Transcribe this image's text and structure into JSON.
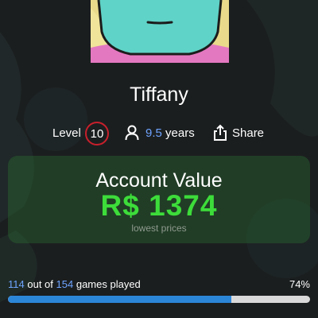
{
  "profile": {
    "username": "Tiffany",
    "level_label": "Level",
    "level": "10",
    "years_value": "9.5",
    "years_unit": "years",
    "share_label": "Share",
    "icons": {
      "account_age": "person-icon",
      "share": "share-icon"
    }
  },
  "account_value": {
    "title": "Account Value",
    "amount": "R$ 1374",
    "subtitle": "lowest prices"
  },
  "progress": {
    "played": "114",
    "out_of": "out of",
    "total": "154",
    "suffix": "games played",
    "percent_label": "74%",
    "fraction": 0.74
  },
  "colors": {
    "level_ring": "#c8202c",
    "accent_blue": "#6ea4ff",
    "value_green": "#3ddc3a",
    "bar_fill": "#2c86d8"
  }
}
